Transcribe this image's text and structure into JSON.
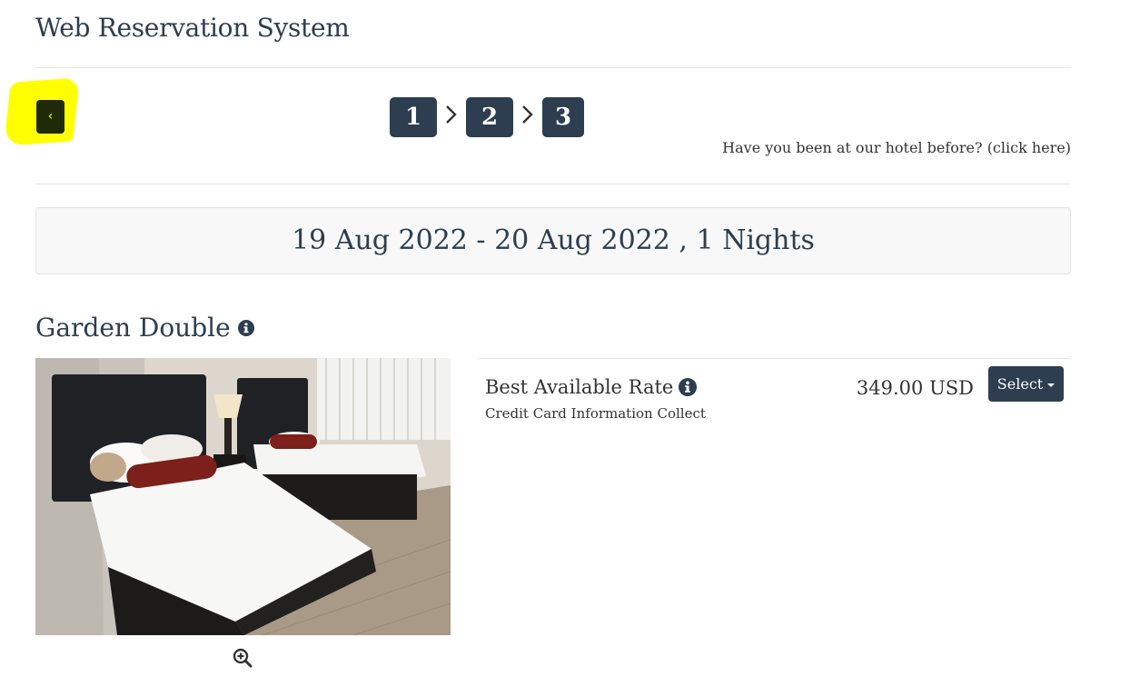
{
  "header": {
    "title": "Web Reservation System"
  },
  "navigation": {
    "back_label": "‹",
    "steps": [
      "1",
      "2",
      "3"
    ],
    "returning_guest_link": "Have you been at our hotel before? (click here)"
  },
  "stay": {
    "dates": "19 Aug 2022 - 20 Aug 2022 , 1 Nights"
  },
  "room": {
    "name": "Garden Double",
    "info_icon": "info-circle-icon",
    "zoom_icon": "zoom-in-icon"
  },
  "rate": {
    "name": "Best Available Rate",
    "note": "Credit Card Information Collect",
    "price": "349.00 USD",
    "select_label": "Select"
  },
  "colors": {
    "primary": "#2c3e50",
    "highlight": "#ffff00",
    "back_button_bg": "#1f2a09",
    "date_box_bg": "#f8f8f8"
  }
}
